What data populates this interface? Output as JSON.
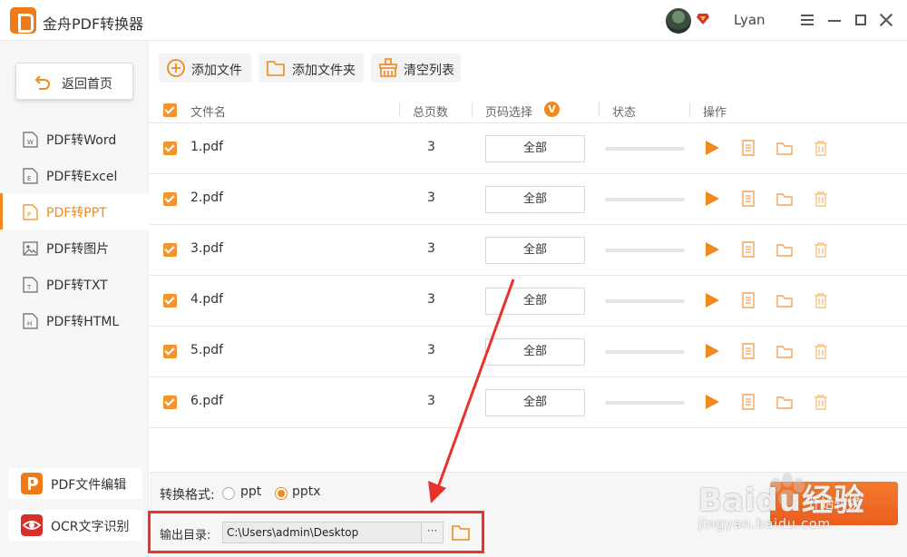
{
  "app": {
    "title": "金舟PDF转换器",
    "username": "Lyan"
  },
  "sidebar": {
    "back_label": "返回首页",
    "items": [
      {
        "label": "PDF转Word",
        "icon": "word-doc-icon",
        "letter": "W",
        "active": false
      },
      {
        "label": "PDF转Excel",
        "icon": "excel-doc-icon",
        "letter": "E",
        "active": false
      },
      {
        "label": "PDF转PPT",
        "icon": "ppt-doc-icon",
        "letter": "P",
        "active": true
      },
      {
        "label": "PDF转图片",
        "icon": "image-doc-icon",
        "letter": "",
        "active": false
      },
      {
        "label": "PDF转TXT",
        "icon": "txt-doc-icon",
        "letter": "T",
        "active": false
      },
      {
        "label": "PDF转HTML",
        "icon": "html-doc-icon",
        "letter": "H",
        "active": false
      }
    ],
    "tools": [
      {
        "label": "PDF文件编辑",
        "icon": "pdf-edit-icon"
      },
      {
        "label": "OCR文字识别",
        "icon": "ocr-eye-icon"
      }
    ]
  },
  "toolbar": {
    "add_file": "添加文件",
    "add_folder": "添加文件夹",
    "clear_list": "清空列表"
  },
  "table": {
    "headers": {
      "name": "文件名",
      "pages": "总页数",
      "page_select": "页码选择",
      "status": "状态",
      "actions": "操作"
    },
    "badge": "V",
    "rows": [
      {
        "name": "1.pdf",
        "pages": "3",
        "page_select": "全部"
      },
      {
        "name": "2.pdf",
        "pages": "3",
        "page_select": "全部"
      },
      {
        "name": "3.pdf",
        "pages": "3",
        "page_select": "全部"
      },
      {
        "name": "4.pdf",
        "pages": "3",
        "page_select": "全部"
      },
      {
        "name": "5.pdf",
        "pages": "3",
        "page_select": "全部"
      },
      {
        "name": "6.pdf",
        "pages": "3",
        "page_select": "全部"
      }
    ]
  },
  "bottom": {
    "format_label": "转换格式:",
    "formats": [
      {
        "label": "ppt",
        "selected": false
      },
      {
        "label": "pptx",
        "selected": true
      }
    ],
    "output_label": "输出目录:",
    "output_path": "C:\\Users\\admin\\Desktop",
    "browse_label": "···",
    "convert_label": "开始转换"
  },
  "watermark": {
    "text": "Baidu经验",
    "sub": "jingyan.baidu.com"
  },
  "colors": {
    "accent": "#f08a1c",
    "annotation": "#e8322e"
  }
}
